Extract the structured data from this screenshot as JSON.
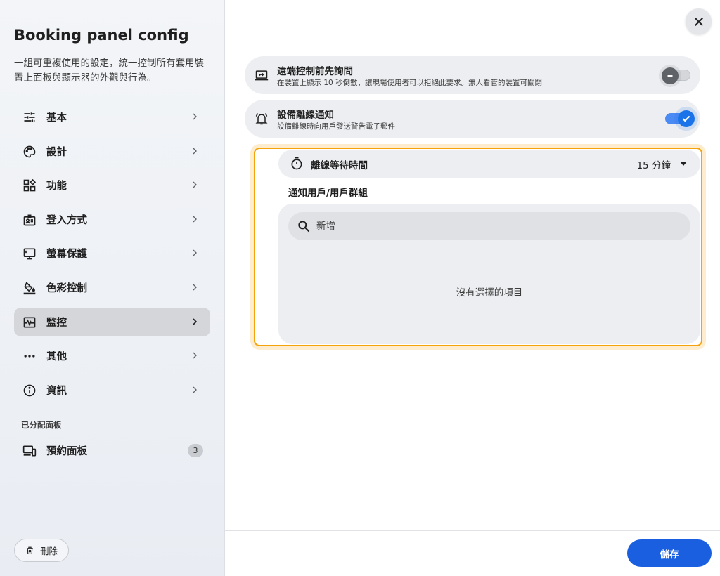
{
  "sidebar": {
    "title": "Booking panel config",
    "description": "一組可重複使用的設定，統一控制所有套用裝置上面板與顯示器的外觀與行為。",
    "items": [
      {
        "label": "基本",
        "icon": "tune-icon"
      },
      {
        "label": "設計",
        "icon": "palette-icon"
      },
      {
        "label": "功能",
        "icon": "widgets-icon"
      },
      {
        "label": "登入方式",
        "icon": "badge-icon"
      },
      {
        "label": "螢幕保護",
        "icon": "monitor-icon"
      },
      {
        "label": "色彩控制",
        "icon": "paint-bucket-icon"
      },
      {
        "label": "監控",
        "icon": "monitoring-icon",
        "active": true
      },
      {
        "label": "其他",
        "icon": "more-horiz-icon"
      },
      {
        "label": "資訊",
        "icon": "info-icon"
      }
    ],
    "assigned_section": "已分配面板",
    "assigned_item": {
      "label": "預約面板",
      "badge": "3"
    },
    "delete_label": "刪除"
  },
  "main": {
    "settings": [
      {
        "title": "遠端控制前先詢問",
        "subtitle": "在裝置上顯示 10 秒倒數，讓現場使用者可以拒絕此要求。無人看管的裝置可關閉",
        "enabled": false
      },
      {
        "title": "設備離線通知",
        "subtitle": "設備離線時向用戶發送警告電子郵件",
        "enabled": true
      }
    ],
    "offline_timeout": {
      "label": "離線等待時間",
      "value": "15 分鐘"
    },
    "notify_label": "通知用戶/用戶群組",
    "search_placeholder": "新增",
    "empty_text": "沒有選擇的項目"
  },
  "footer": {
    "save_label": "儲存"
  },
  "colors": {
    "accent": "#1a5fe0",
    "highlight": "#f4a30a",
    "toggle_on": "#1a73e8"
  }
}
